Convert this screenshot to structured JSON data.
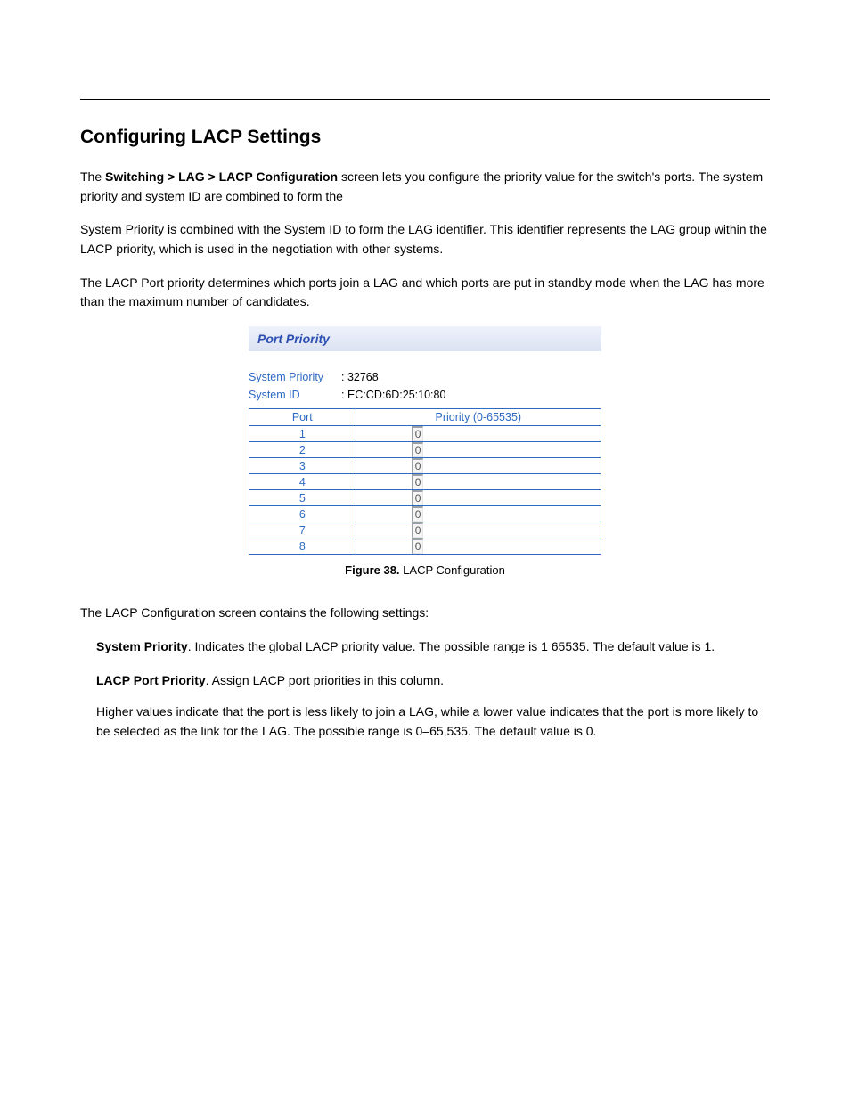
{
  "page": {
    "heading": "Configuring LACP Settings",
    "intro_1": "The ",
    "intro_bold": "Switching > LAG > LACP Configuration",
    "intro_2": " screen lets you configure the priority value for the switch's ports. The system priority and system ID are combined to form the",
    "intro_3": "System Priority is combined with the System ID to form the LAG identifier. This identifier represents the LAG group within the LACP priority, which is used in the negotiation with other systems.",
    "intro_4": "The LACP Port priority determines which ports join a LAG and which ports are put in standby mode when the LAG has more than the maximum number of candidates.",
    "figure_label": "Figure 38. ",
    "figure_caption": "LACP Configuration",
    "settings_intro": "The LACP Configuration screen contains the following settings:",
    "s1_label": "System Priority",
    "s1_text": ". Indicates the global LACP priority value. The possible range is 1 65535. The default value is 1.",
    "s2_label": "LACP Port Priority",
    "s2_text_a": ". Assign LACP port priorities in this column.",
    "s2_text_b": "Higher values indicate that the port is less likely to join a LAG, while a lower value indicates that the port is more likely to be selected as the link for the LAG. The possible range is ",
    "s2_range": "0–65,535",
    "s2_text_c": ". The default value is 0."
  },
  "ui": {
    "title": "Port Priority",
    "sys_priority_label": "System Priority",
    "sys_priority_value": "32768",
    "sys_id_label": "System ID",
    "sys_id_value": "EC:CD:6D:25:10:80",
    "col_port": "Port",
    "col_priority": "Priority (0-65535)",
    "rows": [
      {
        "port": "1",
        "priority": "0"
      },
      {
        "port": "2",
        "priority": "0"
      },
      {
        "port": "3",
        "priority": "0"
      },
      {
        "port": "4",
        "priority": "0"
      },
      {
        "port": "5",
        "priority": "0"
      },
      {
        "port": "6",
        "priority": "0"
      },
      {
        "port": "7",
        "priority": "0"
      },
      {
        "port": "8",
        "priority": "0"
      }
    ]
  }
}
